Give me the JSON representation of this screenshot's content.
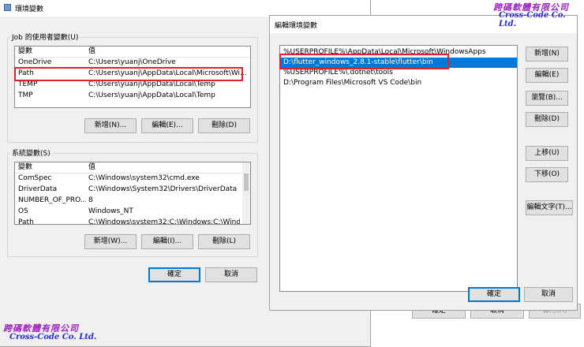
{
  "env_dialog": {
    "title": "環境變數",
    "user_group_label": "Job 的使用者變數(U)",
    "columns": [
      "變數",
      "值"
    ],
    "user_vars": [
      {
        "name": "OneDrive",
        "value": "C:\\Users\\yuanj\\OneDrive"
      },
      {
        "name": "Path",
        "value": "C:\\Users\\yuanj\\AppData\\Local\\Microsoft\\Wi..."
      },
      {
        "name": "TEMP",
        "value": "C:\\Users\\yuanj\\AppData\\Local\\Temp"
      },
      {
        "name": "TMP",
        "value": "C:\\Users\\yuanj\\AppData\\Local\\Temp"
      }
    ],
    "user_buttons": {
      "new": "新增(N)...",
      "edit": "編輯(E)...",
      "delete": "刪除(D)"
    },
    "system_group_label": "系統變數(S)",
    "system_vars": [
      {
        "name": "ComSpec",
        "value": "C:\\Windows\\system32\\cmd.exe"
      },
      {
        "name": "DriverData",
        "value": "C:\\Windows\\System32\\Drivers\\DriverData"
      },
      {
        "name": "NUMBER_OF_PRO...",
        "value": "8"
      },
      {
        "name": "OS",
        "value": "Windows_NT"
      },
      {
        "name": "Path",
        "value": "C:\\Windows\\system32;C:\\Windows;C:\\Wind..."
      }
    ],
    "system_buttons": {
      "new": "新增(W)...",
      "edit": "編輯(I)...",
      "delete": "刪除(L)"
    },
    "ok": "確定",
    "cancel": "取消"
  },
  "edit_dialog": {
    "title": "編輯環境變數",
    "entries": [
      "%USERPROFILE%\\AppData\\Local\\Microsoft\\WindowsApps",
      "D:\\flutter_windows_2.8.1-stable\\flutter\\bin",
      "%USERPROFILE%\\.dotnet\\tools",
      "D:\\Program Files\\Microsoft VS Code\\bin"
    ],
    "selected_index": 1,
    "buttons": {
      "new": "新增(N)",
      "edit": "編輯(E)",
      "browse": "瀏覽(B)...",
      "delete": "刪除(D)",
      "move_up": "上移(U)",
      "move_down": "下移(O)",
      "edit_text": "編輯文字(T)..."
    },
    "ok": "確定",
    "cancel": "取消"
  },
  "background_buttons": {
    "ok": "確定",
    "cancel": "取消",
    "apply": "套用(A)"
  },
  "watermark": {
    "cn": "跨碼軟體有限公司",
    "en": "Cross-Code Co. Ltd."
  },
  "colors": {
    "selection": "#0078d7",
    "highlight_box": "#e0202a",
    "watermark_cn": "#a020c0",
    "watermark_en": "#2a2ad0"
  }
}
